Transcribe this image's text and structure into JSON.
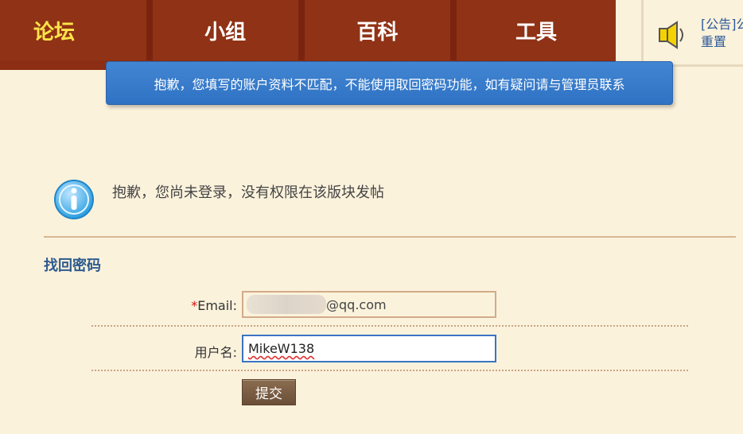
{
  "nav": {
    "tabs": [
      {
        "label": "论坛",
        "active": true
      },
      {
        "label": "小组",
        "active": false
      },
      {
        "label": "百科",
        "active": false
      },
      {
        "label": "工具",
        "active": false
      }
    ]
  },
  "announcement": {
    "line1": "[公告]公",
    "line2": "重置",
    "icon": "speaker-icon"
  },
  "tooltip": {
    "text": "抱歉，您填写的账户资料不匹配，不能使用取回密码功能，如有疑问请与管理员联系"
  },
  "notice": {
    "icon": "info-icon",
    "text": "抱歉，您尚未登录，没有权限在该版块发帖"
  },
  "form": {
    "title": "找回密码",
    "email_required": "*",
    "email_label": "Email:",
    "email_value": "@qq.com",
    "username_label": "用户名:",
    "username_value": "MikeW138",
    "submit_label": "提交"
  },
  "colors": {
    "nav_bg": "#8c2e14",
    "active_tab": "#ffe54a",
    "page_bg": "#fbf2dc",
    "tooltip_bg": "#3a7ccc",
    "title": "#2d5b8e"
  }
}
